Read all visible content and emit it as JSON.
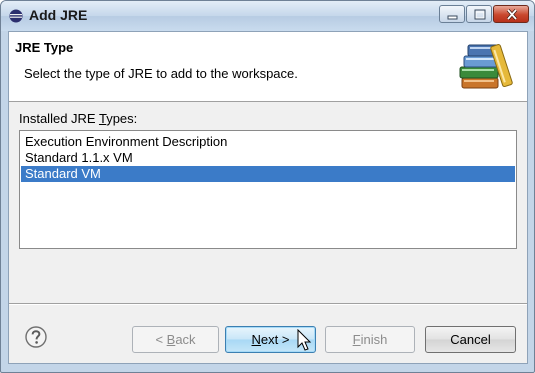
{
  "window": {
    "title": "Add JRE"
  },
  "header": {
    "title": "JRE Type",
    "description": "Select the type of JRE to add to the workspace.",
    "icon": "jre-books-icon"
  },
  "jre_types": {
    "label_before": "Installed JRE ",
    "label_mnemonic": "T",
    "label_after": "ypes:",
    "items": [
      {
        "label": "Execution Environment Description",
        "selected": false
      },
      {
        "label": "Standard 1.1.x VM",
        "selected": false
      },
      {
        "label": "Standard VM",
        "selected": true
      }
    ]
  },
  "buttons": {
    "back": {
      "prefix": "< ",
      "mnemonic": "B",
      "rest": "ack",
      "enabled": false
    },
    "next": {
      "mnemonic": "N",
      "rest": "ext >",
      "enabled": true
    },
    "finish": {
      "mnemonic": "F",
      "rest": "inish",
      "enabled": false
    },
    "cancel": {
      "label": "Cancel",
      "enabled": true
    }
  },
  "colors": {
    "selection": "#3b7bc8",
    "focus_button": "#a8d8f5",
    "close_button": "#c9482e"
  }
}
